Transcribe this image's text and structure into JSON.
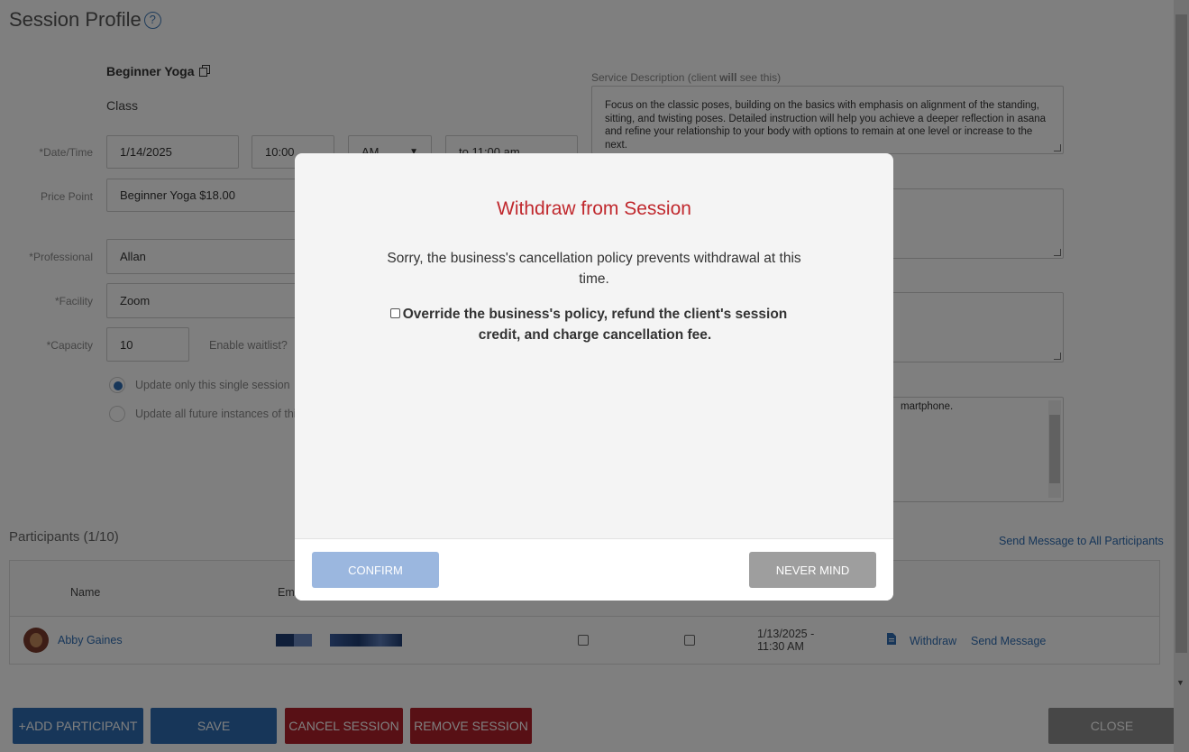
{
  "page": {
    "title": "Session Profile",
    "help_glyph": "?"
  },
  "session": {
    "name": "Beginner Yoga",
    "type": "Class",
    "date_label": "*Date/Time",
    "date": "1/14/2025",
    "time": "10:00",
    "ampm": "AM",
    "end_time": "to 11:00 am",
    "price_label": "Price Point",
    "price": "Beginner Yoga $18.00",
    "professional_label": "*Professional",
    "professional": "Allan",
    "facility_label": "*Facility",
    "facility": "Zoom",
    "capacity_label": "*Capacity",
    "capacity": "10",
    "waitlist_label": "Enable waitlist?",
    "radio_single": "Update only this single session",
    "radio_future": "Update all future instances of this"
  },
  "description": {
    "label_prefix": "Service Description (client ",
    "label_bold": "will",
    "label_suffix": " see this)",
    "text": "Focus on the classic poses, building on the basics with emphasis on alignment of the standing, sitting, and twisting poses. Detailed instruction will help you achieve a deeper reflection in asana and refine your relationship to your body with options to remain at one level or increase to the next.",
    "fragment_4": "martphone."
  },
  "participants": {
    "title": "Participants (1/10)",
    "send_all": "Send Message to All Participants",
    "col_name": "Name",
    "col_email": "Em",
    "rows": [
      {
        "name": "Abby Gaines",
        "date": "1/13/2025 -",
        "time": "11:30 AM",
        "withdraw": "Withdraw",
        "send": "Send Message"
      }
    ]
  },
  "buttons": {
    "add": "+ADD PARTICIPANT",
    "save": "SAVE",
    "cancel": "CANCEL SESSION",
    "remove": "REMOVE SESSION",
    "close": "CLOSE"
  },
  "modal": {
    "title": "Withdraw from Session",
    "message": "Sorry, the business's cancellation policy prevents withdrawal at this time.",
    "override": "Override the business's policy, refund the client's session credit, and charge cancellation fee.",
    "confirm": "CONFIRM",
    "never_mind": "NEVER MIND"
  },
  "colors": {
    "accent_blue": "#2e6db3",
    "danger_red": "#b0202a",
    "title_red": "#c0282d",
    "confirm_disabled": "#9bb7df",
    "never_mind_gray": "#9e9e9e"
  },
  "icons": {
    "copy": "copy-icon",
    "help": "help-icon",
    "document": "document-icon",
    "select": "chevron-down-icon"
  }
}
